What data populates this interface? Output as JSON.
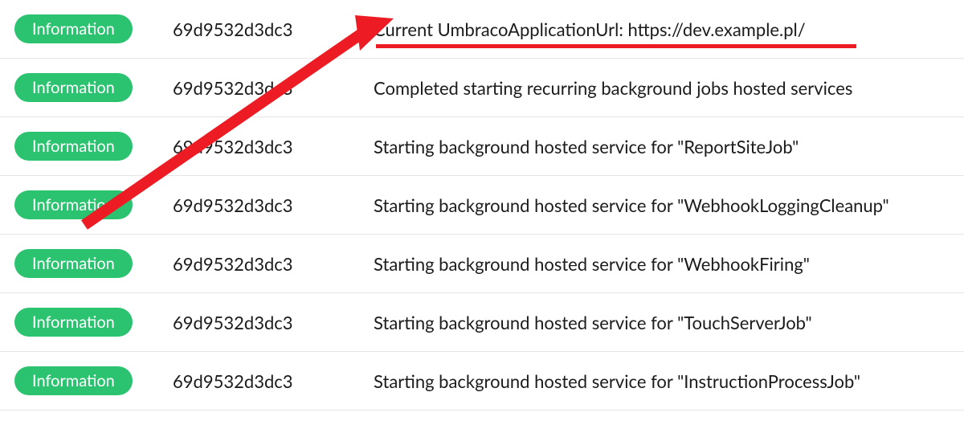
{
  "logs": {
    "rows": [
      {
        "level": "Information",
        "id": "69d9532d3dc3",
        "message": "Current UmbracoApplicationUrl: https://dev.example.pl/"
      },
      {
        "level": "Information",
        "id": "69d9532d3dc3",
        "message": "Completed starting recurring background jobs hosted services"
      },
      {
        "level": "Information",
        "id": "69d9532d3dc3",
        "message": "Starting background hosted service for \"ReportSiteJob\""
      },
      {
        "level": "Information",
        "id": "69d9532d3dc3",
        "message": "Starting background hosted service for \"WebhookLoggingCleanup\""
      },
      {
        "level": "Information",
        "id": "69d9532d3dc3",
        "message": "Starting background hosted service for \"WebhookFiring\""
      },
      {
        "level": "Information",
        "id": "69d9532d3dc3",
        "message": "Starting background hosted service for \"TouchServerJob\""
      },
      {
        "level": "Information",
        "id": "69d9532d3dc3",
        "message": "Starting background hosted service for \"InstructionProcessJob\""
      }
    ]
  },
  "annotation": {
    "underline_color": "#ed1c24",
    "arrow_color": "#ed1c24"
  }
}
